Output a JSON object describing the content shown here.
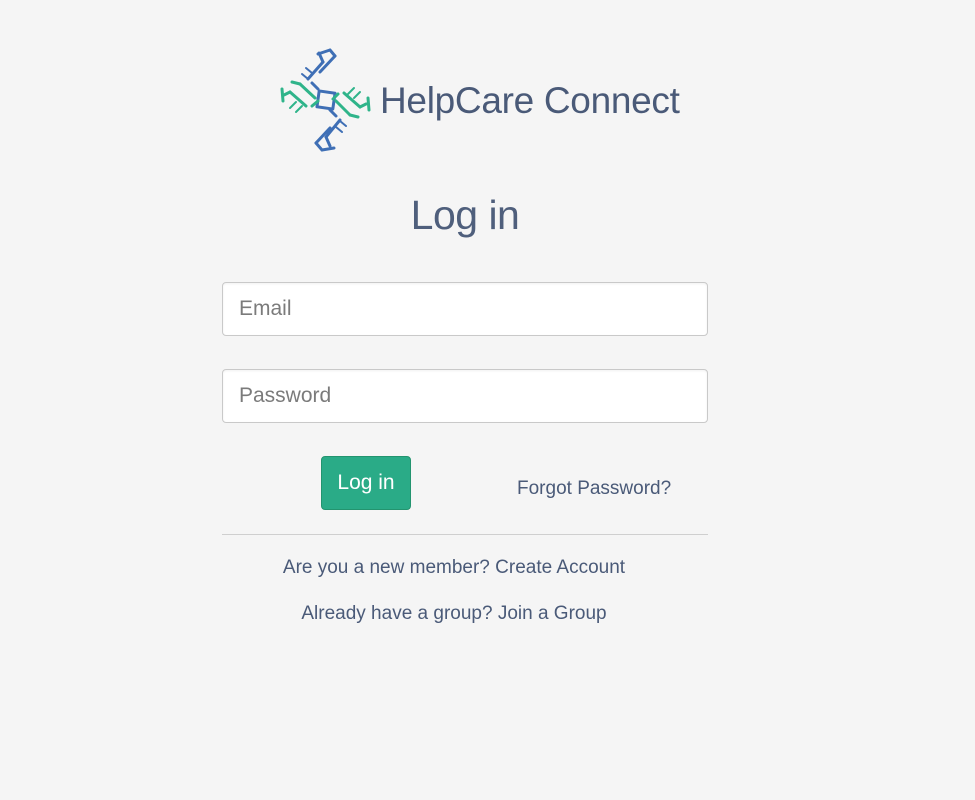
{
  "brand": {
    "name": "HelpCare Connect",
    "logo_icon": "helping-hands-logo-icon",
    "colors": {
      "blue": "#3f6fb5",
      "green": "#2fb48a"
    }
  },
  "form": {
    "title": "Log in",
    "email_placeholder": "Email",
    "password_placeholder": "Password",
    "email_value": "",
    "password_value": "",
    "login_label": "Log in",
    "forgot_label": "Forgot Password?"
  },
  "footer": {
    "new_member_prompt": "Are you a new member?",
    "create_account_label": "Create Account",
    "group_prompt": "Already have a group?",
    "join_group_label": "Join a Group"
  },
  "colors": {
    "background": "#f5f5f5",
    "primary_button": "#2aab87",
    "text": "#4a5a78"
  }
}
